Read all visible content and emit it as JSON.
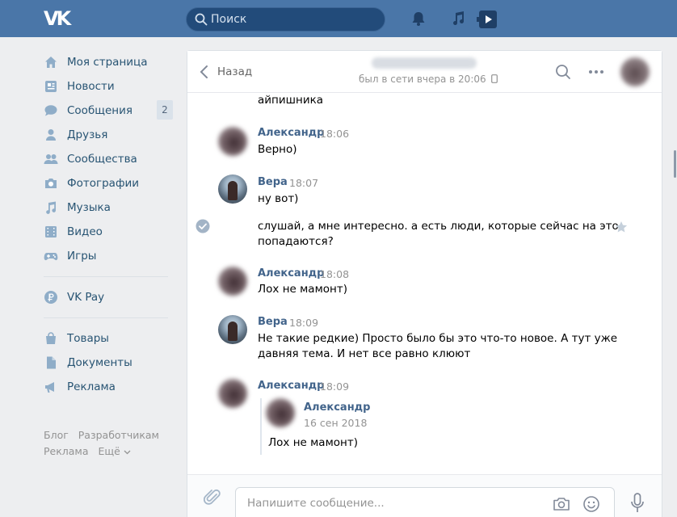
{
  "topbar": {
    "logo": "VK",
    "search_placeholder": "Поиск",
    "accent": "#4a76a8"
  },
  "sidebar": {
    "items": [
      {
        "label": "Моя страница",
        "icon": "home-icon"
      },
      {
        "label": "Новости",
        "icon": "news-icon"
      },
      {
        "label": "Сообщения",
        "icon": "messages-icon",
        "badge": "2"
      },
      {
        "label": "Друзья",
        "icon": "friends-icon"
      },
      {
        "label": "Сообщества",
        "icon": "groups-icon"
      },
      {
        "label": "Фотографии",
        "icon": "camera-icon"
      },
      {
        "label": "Музыка",
        "icon": "music-icon"
      },
      {
        "label": "Видео",
        "icon": "video-icon"
      },
      {
        "label": "Игры",
        "icon": "gamepad-icon"
      }
    ],
    "pay": {
      "label": "VK Pay",
      "icon": "vkpay-icon"
    },
    "extra": [
      {
        "label": "Товары",
        "icon": "shop-icon"
      },
      {
        "label": "Документы",
        "icon": "document-icon"
      },
      {
        "label": "Реклама",
        "icon": "megaphone-icon"
      }
    ],
    "footer": {
      "blog": "Блог",
      "dev": "Разработчикам",
      "ads": "Реклама",
      "more": "Ещё"
    }
  },
  "chat": {
    "back_label": "Назад",
    "status": "был в сети вчера в 20:06",
    "messages": {
      "m0_text": "айпишника",
      "m1_author": "Александр",
      "m1_time": "18:06",
      "m1_text": "Верно)",
      "m2_author": "Вера",
      "m2_time": "18:07",
      "m2_text": "ну вот)",
      "m3_line1": "слушай, а мне интересно. а есть люди, которые сейчас на это",
      "m3_line2": "попадаются?",
      "m4_author": "Александр",
      "m4_time": "18:08",
      "m4_text": "Лох не мамонт)",
      "m5_author": "Вера",
      "m5_time": "18:09",
      "m5_line1": "Не такие редкие) Просто было бы это что-то новое. А тут уже",
      "m5_line2": "давняя тема. И нет все равно клюют",
      "m6_author": "Александр",
      "m6_time": "18:09",
      "fwd_author": "Александр",
      "fwd_date": "16 сен 2018",
      "fwd_text": "Лох не мамонт)"
    },
    "composer_placeholder": "Напишите сообщение..."
  }
}
